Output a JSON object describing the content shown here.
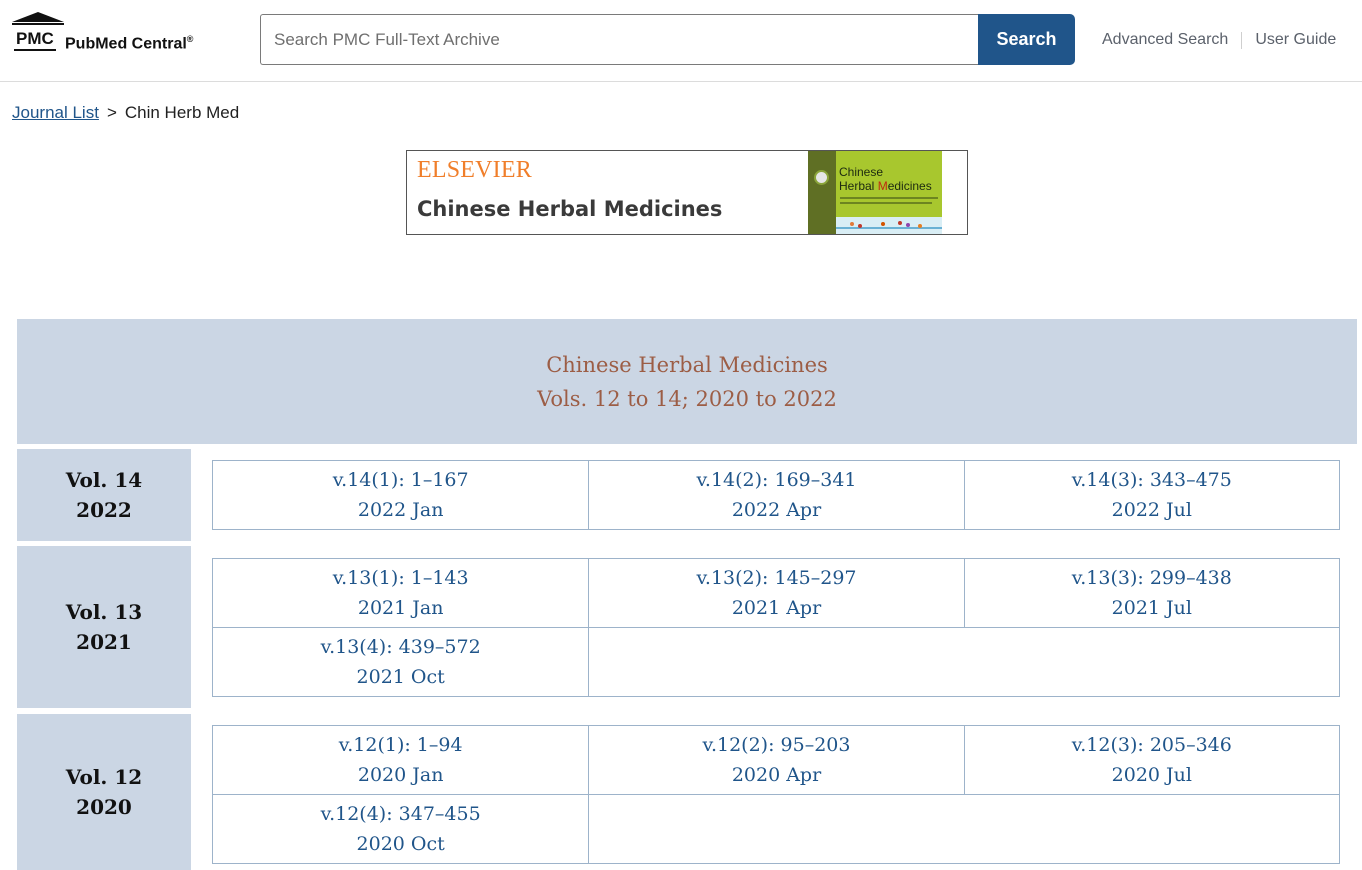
{
  "header": {
    "logo_abbrev": "PMC",
    "logo_name": "PubMed Central",
    "logo_mark": "®",
    "search_placeholder": "Search PMC Full-Text Archive",
    "search_button": "Search",
    "links": [
      "Advanced Search",
      "User Guide"
    ]
  },
  "breadcrumb": {
    "link": "Journal List",
    "separator": ">",
    "current": "Chin Herb Med"
  },
  "banner": {
    "publisher": "ELSEVIER",
    "journal": "Chinese Herbal Medicines",
    "cover_line1": "Chinese",
    "cover_line2_h": "Herbal ",
    "cover_line2_m": "M",
    "cover_line2_rest": "edicines"
  },
  "archive": {
    "title": "Chinese Herbal Medicines",
    "subtitle": "Vols. 12 to 14;  2020 to 2022"
  },
  "volumes": [
    {
      "vol": "Vol. 14",
      "year": "2022",
      "issues": [
        {
          "issue": "v.14(1): 1–167",
          "date": "2022 Jan"
        },
        {
          "issue": "v.14(2): 169–341",
          "date": "2022 Apr"
        },
        {
          "issue": "v.14(3): 343–475",
          "date": "2022 Jul"
        }
      ]
    },
    {
      "vol": "Vol. 13",
      "year": "2021",
      "issues": [
        {
          "issue": "v.13(1): 1–143",
          "date": "2021 Jan"
        },
        {
          "issue": "v.13(2): 145–297",
          "date": "2021 Apr"
        },
        {
          "issue": "v.13(3): 299–438",
          "date": "2021 Jul"
        },
        {
          "issue": "v.13(4): 439–572",
          "date": "2021 Oct"
        }
      ]
    },
    {
      "vol": "Vol. 12",
      "year": "2020",
      "issues": [
        {
          "issue": "v.12(1): 1–94",
          "date": "2020 Jan"
        },
        {
          "issue": "v.12(2): 95–203",
          "date": "2020 Apr"
        },
        {
          "issue": "v.12(3): 205–346",
          "date": "2020 Jul"
        },
        {
          "issue": "v.12(4): 347–455",
          "date": "2020 Oct"
        }
      ]
    }
  ]
}
